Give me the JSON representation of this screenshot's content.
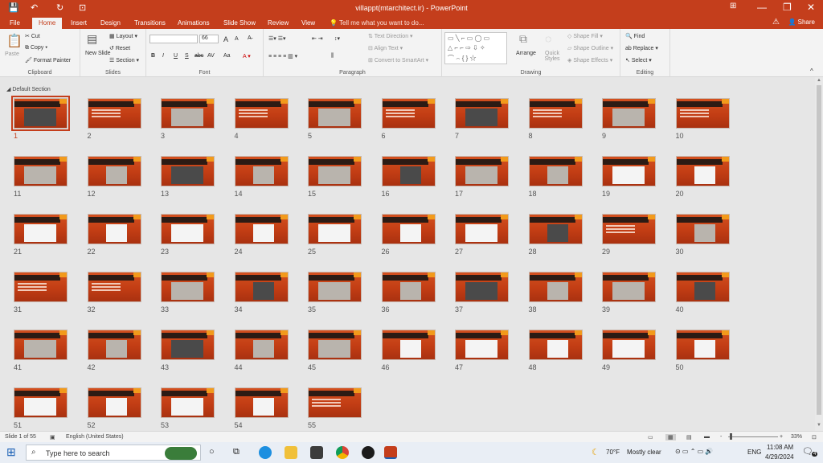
{
  "titlebar": {
    "title": "villappt(mtarchitect.ir) - PowerPoint",
    "qa_save": "💾",
    "qa_undo": "↶",
    "qa_redo": "↻",
    "qa_present": "⊡",
    "min": "—",
    "restore": "❐",
    "close": "✕",
    "ribbon_opts": "⊞"
  },
  "tabs": [
    "File",
    "Home",
    "Insert",
    "Design",
    "Transitions",
    "Animations",
    "Slide Show",
    "Review",
    "View"
  ],
  "tell_me": "Tell me what you want to do...",
  "share": "Share",
  "clipboard": {
    "paste": "Paste",
    "cut": "Cut",
    "copy": "Copy",
    "format_painter": "Format Painter",
    "label": "Clipboard"
  },
  "slides_grp": {
    "new_slide": "New Slide",
    "layout": "Layout",
    "reset": "Reset",
    "section": "Section",
    "label": "Slides"
  },
  "font_grp": {
    "font_size": "66",
    "label": "Font",
    "bold": "B",
    "italic": "I",
    "underline": "U",
    "strike": "S",
    "shadow": "abc",
    "spacing": "AV",
    "case": "Aa",
    "grow": "A",
    "shrink": "A"
  },
  "para_grp": {
    "text_direction": "Text Direction",
    "align_text": "Align Text",
    "smartart": "Convert to SmartArt",
    "label": "Paragraph"
  },
  "drawing_grp": {
    "arrange": "Arrange",
    "quick_styles": "Quick Styles",
    "shape_fill": "Shape Fill",
    "shape_outline": "Shape Outline",
    "shape_effects": "Shape Effects",
    "label": "Drawing"
  },
  "editing_grp": {
    "find": "Find",
    "replace": "Replace",
    "select": "Select",
    "label": "Editing"
  },
  "section_name": "Default Section",
  "slides": [
    {
      "n": "1",
      "style": "photo"
    },
    {
      "n": "2",
      "style": "text"
    },
    {
      "n": "3",
      "style": "photo"
    },
    {
      "n": "4",
      "style": "text"
    },
    {
      "n": "5",
      "style": "photo"
    },
    {
      "n": "6",
      "style": "text"
    },
    {
      "n": "7",
      "style": "photo"
    },
    {
      "n": "8",
      "style": "text"
    },
    {
      "n": "9",
      "style": "photo"
    },
    {
      "n": "10",
      "style": "text"
    },
    {
      "n": "11",
      "style": "photo"
    },
    {
      "n": "12",
      "style": "photo"
    },
    {
      "n": "13",
      "style": "photo"
    },
    {
      "n": "14",
      "style": "photo"
    },
    {
      "n": "15",
      "style": "photo"
    },
    {
      "n": "16",
      "style": "photo"
    },
    {
      "n": "17",
      "style": "photo"
    },
    {
      "n": "18",
      "style": "photo"
    },
    {
      "n": "19",
      "style": "drawing"
    },
    {
      "n": "20",
      "style": "drawing"
    },
    {
      "n": "21",
      "style": "drawing"
    },
    {
      "n": "22",
      "style": "drawing"
    },
    {
      "n": "23",
      "style": "drawing"
    },
    {
      "n": "24",
      "style": "drawing"
    },
    {
      "n": "25",
      "style": "drawing"
    },
    {
      "n": "26",
      "style": "drawing"
    },
    {
      "n": "27",
      "style": "drawing"
    },
    {
      "n": "28",
      "style": "photo"
    },
    {
      "n": "29",
      "style": "text"
    },
    {
      "n": "30",
      "style": "photo"
    },
    {
      "n": "31",
      "style": "text"
    },
    {
      "n": "32",
      "style": "text"
    },
    {
      "n": "33",
      "style": "photo"
    },
    {
      "n": "34",
      "style": "photo"
    },
    {
      "n": "35",
      "style": "photo"
    },
    {
      "n": "36",
      "style": "photo"
    },
    {
      "n": "37",
      "style": "photo"
    },
    {
      "n": "38",
      "style": "photo"
    },
    {
      "n": "39",
      "style": "photo"
    },
    {
      "n": "40",
      "style": "photo"
    },
    {
      "n": "41",
      "style": "photo"
    },
    {
      "n": "42",
      "style": "photo"
    },
    {
      "n": "43",
      "style": "photo"
    },
    {
      "n": "44",
      "style": "photo"
    },
    {
      "n": "45",
      "style": "photo"
    },
    {
      "n": "46",
      "style": "drawing"
    },
    {
      "n": "47",
      "style": "drawing"
    },
    {
      "n": "48",
      "style": "drawing"
    },
    {
      "n": "49",
      "style": "drawing"
    },
    {
      "n": "50",
      "style": "drawing"
    },
    {
      "n": "51",
      "style": "drawing"
    },
    {
      "n": "52",
      "style": "drawing"
    },
    {
      "n": "53",
      "style": "drawing"
    },
    {
      "n": "54",
      "style": "drawing"
    },
    {
      "n": "55",
      "style": "text"
    }
  ],
  "status": {
    "slide_of": "Slide 1 of 55",
    "language": "English (United States)",
    "zoom": "33%",
    "zoom_minus": "-",
    "zoom_plus": "+"
  },
  "taskbar": {
    "search_placeholder": "Type here to search",
    "weather_temp": "70°F",
    "weather_desc": "Mostly clear",
    "lang": "ENG",
    "time": "11:08 AM",
    "date": "4/29/2024",
    "notif_count": "4"
  }
}
